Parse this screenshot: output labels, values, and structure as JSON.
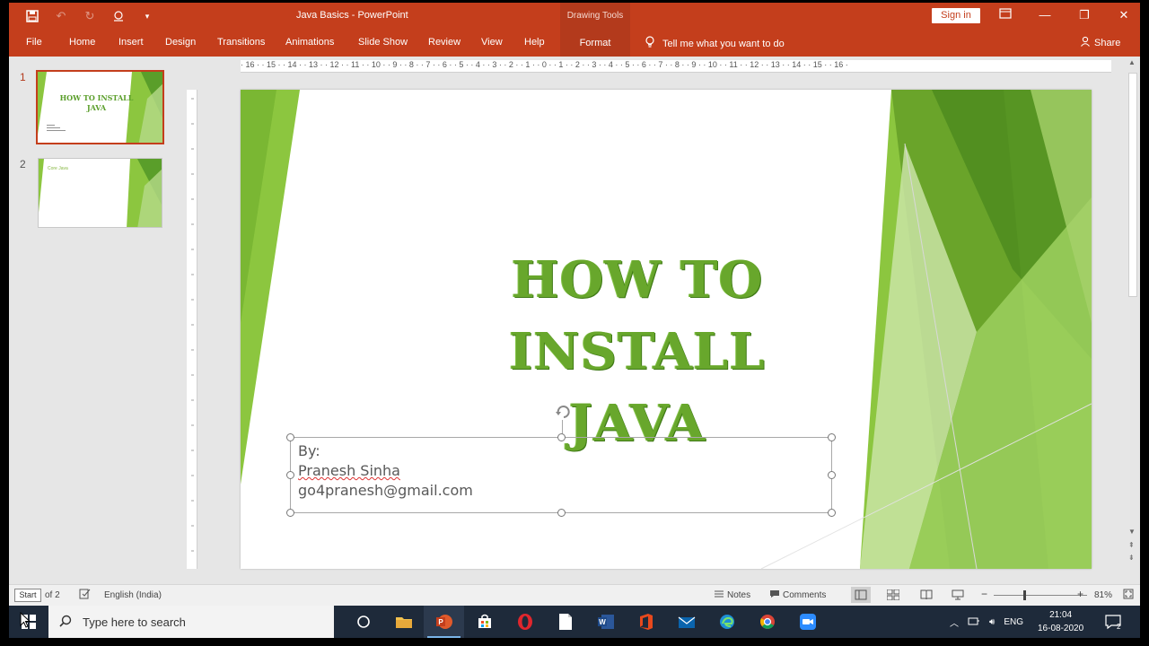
{
  "titlebar": {
    "doc_title": "Java Basics  -  PowerPoint",
    "context_group": "Drawing Tools",
    "signin": "Sign in",
    "qat_icons": [
      "save-icon",
      "undo-icon",
      "redo-icon",
      "touch-mode-icon",
      "customize-qat-icon"
    ]
  },
  "ribbon": {
    "tabs": [
      "File",
      "Home",
      "Insert",
      "Design",
      "Transitions",
      "Animations",
      "Slide Show",
      "Review",
      "View",
      "Help"
    ],
    "context_tab": "Format",
    "tell_me": "Tell me what you want to do",
    "share": "Share"
  },
  "thumbnails": [
    {
      "num": "1",
      "title": "HOW TO INSTALL JAVA",
      "selected": true
    },
    {
      "num": "2",
      "title": "Core Java",
      "selected": false
    }
  ],
  "ruler": {
    "horizontal": "· 16 · · 15 · · 14 · · 13 · · 12 · · 11 · · 10 · · 9 · · 8 · · 7 · · 6 · · 5 · · 4 · · 3 · · 2 · · 1 · · 0 · · 1 · · 2 · · 3 · · 4 · · 5 · · 6 · · 7 · · 8 · · 9 · · 10 · · 11 · · 12 · · 13 · · 14 · · 15 · · 16 ·"
  },
  "slide": {
    "title_line1": "HOW TO INSTALL",
    "title_line2": "JAVA",
    "by": "By:",
    "author": "Pranesh Sinha",
    "email": "go4pranesh@gmail.com",
    "accent_color": "#68a72c"
  },
  "statusbar": {
    "slide_box": "Start",
    "slide_of": "of 2",
    "language": "English (India)",
    "notes": "Notes",
    "comments": "Comments",
    "zoom": "81%",
    "zoom_fraction": 0.33
  },
  "taskbar": {
    "search_placeholder": "Type here to search",
    "tray_lang": "ENG",
    "time": "21:04",
    "date": "16-08-2020",
    "notif_count": "2",
    "apps": [
      "cortana",
      "file-explorer",
      "powerpoint",
      "store",
      "opera",
      "notepad",
      "word",
      "office",
      "mail",
      "edge",
      "chrome",
      "zoom"
    ]
  }
}
